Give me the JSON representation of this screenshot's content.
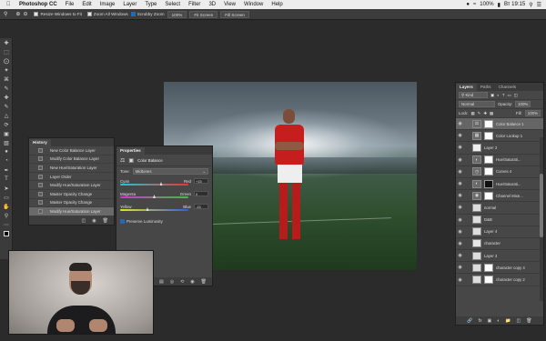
{
  "menubar": {
    "apple": "",
    "app_name": "Photoshop CC",
    "items": [
      "File",
      "Edit",
      "Image",
      "Layer",
      "Type",
      "Select",
      "Filter",
      "3D",
      "View",
      "Window",
      "Help"
    ],
    "battery": "100%",
    "clock": "Вт 19:15"
  },
  "options_bar": {
    "resize_windows": "Resize Windows to Fit",
    "zoom_all": "Zoom All Windows",
    "scrubby_zoom": "Scrubby Zoom",
    "zoom_value": "100%",
    "fit_screen": "Fit Screen",
    "fill_screen": "Fill Screen"
  },
  "history": {
    "tab": "History",
    "items": [
      "New Color Balance Layer",
      "Modify Color Balance Layer",
      "New Hue/Saturation Layer",
      "Layer Order",
      "Modify Hue/Saturation Layer",
      "Master Opacity Change",
      "Master Opacity Change",
      "Modify Hue/Saturation Layer"
    ]
  },
  "properties": {
    "tab": "Properties",
    "adjustment": "Color Balance",
    "tone_label": "Tone:",
    "tone_value": "Midtones",
    "sliders": [
      {
        "left": "Cyan",
        "right": "Red",
        "value": "+15",
        "level": 0.6
      },
      {
        "left": "Magenta",
        "right": "Green",
        "value": "0",
        "level": 0.5
      },
      {
        "left": "Yellow",
        "right": "Blue",
        "value": "-15",
        "level": 0.4
      }
    ],
    "preserve_luminosity": "Preserve Luminosity"
  },
  "layers": {
    "tabs": [
      "Layers",
      "Paths",
      "Channels"
    ],
    "kind_label": "Kind",
    "blend_mode": "Normal",
    "opacity_label": "Opacity:",
    "opacity_value": "100%",
    "lock_label": "Lock:",
    "fill_label": "Fill:",
    "fill_value": "100%",
    "rows": [
      {
        "name": "Color Balance 1",
        "selected": true
      },
      {
        "name": "Color Lookup 1",
        "selected": false
      },
      {
        "name": "Layer 2",
        "selected": false
      },
      {
        "name": "Hue/Saturati...",
        "selected": false
      },
      {
        "name": "Curves 4",
        "selected": false
      },
      {
        "name": "Hue/Saturati...",
        "selected": false
      },
      {
        "name": "Channel Mixe...",
        "selected": false
      },
      {
        "name": "normal",
        "selected": false
      },
      {
        "name": "D&B",
        "selected": false
      },
      {
        "name": "Layer 4",
        "selected": false
      },
      {
        "name": "character",
        "selected": false
      },
      {
        "name": "Layer 3",
        "selected": false
      },
      {
        "name": "character copy 4",
        "selected": false
      },
      {
        "name": "character copy 2",
        "selected": false
      }
    ]
  },
  "colors": {
    "panel_bg": "#474747",
    "app_bg": "#2b2b2b",
    "selection": "#656565",
    "jersey_red": "#c61d1f"
  }
}
